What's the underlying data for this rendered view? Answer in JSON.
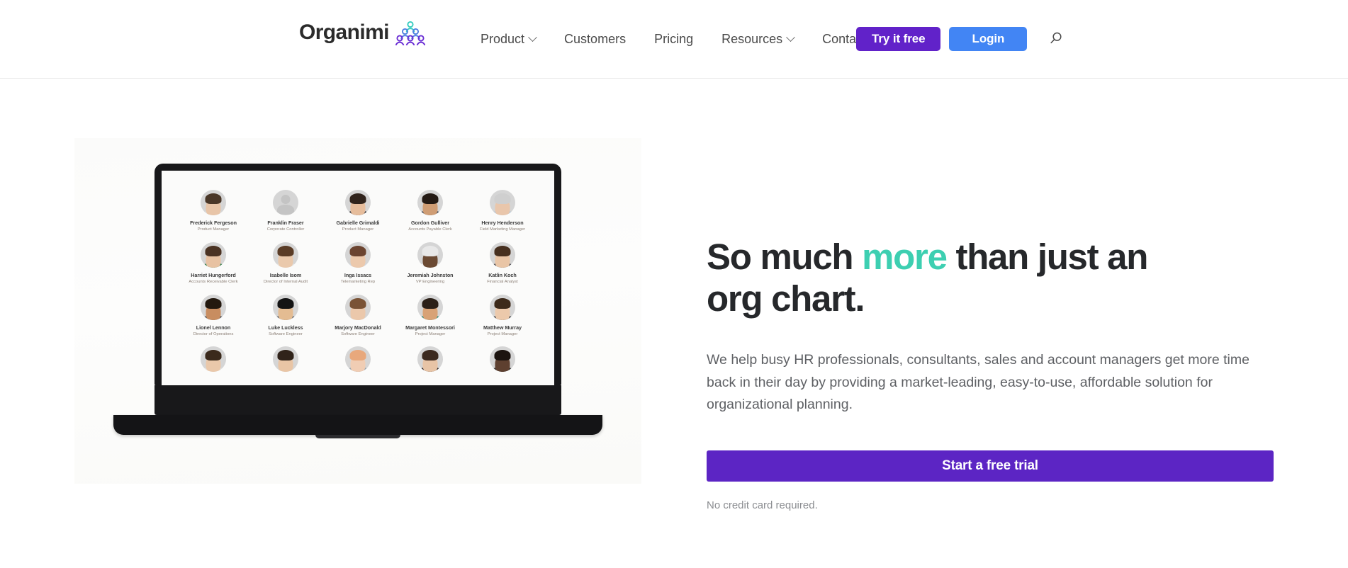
{
  "header": {
    "logo": {
      "wordmark": "Organimi",
      "icon_name": "organimi-pyramid-logo",
      "colors": {
        "top": "#35ccc0",
        "middle": "#4f7fe0",
        "bottom": "#6b2fd4"
      }
    },
    "nav": [
      {
        "label": "Product",
        "has_dropdown": true
      },
      {
        "label": "Customers",
        "has_dropdown": false
      },
      {
        "label": "Pricing",
        "has_dropdown": false
      },
      {
        "label": "Resources",
        "has_dropdown": true
      },
      {
        "label": "Contact Us",
        "has_dropdown": false
      }
    ],
    "buttons": {
      "try_free": {
        "label": "Try it free",
        "color": "#6122c9"
      },
      "login": {
        "label": "Login",
        "color": "#4285f4"
      }
    },
    "search_icon": "search-icon"
  },
  "hero": {
    "title_part1": "So much ",
    "title_accent": "more",
    "title_part2": " than just an org chart.",
    "accent_color": "#3dcfb1",
    "subtitle": "We help busy HR professionals, consultants, sales and account managers get more time back in their day by providing a market-leading, easy-to-use, affordable solution for organizational planning.",
    "cta_label": "Start a free trial",
    "cta_color": "#5c25c4",
    "cta_note": "No credit card required."
  },
  "org_chart": {
    "people": [
      {
        "name": "Frederick Fergeson",
        "title": "Product Manager",
        "avatar": "photo",
        "skin": "#e8c5a8",
        "hair": "#4a3728",
        "shirt": "#dcdcdc"
      },
      {
        "name": "Franklin Fraser",
        "title": "Corporate Controller",
        "avatar": "placeholder",
        "skin": "#c4c4c4",
        "hair": "#c4c4c4",
        "shirt": "#c4c4c4"
      },
      {
        "name": "Gabrielle Grimaldi",
        "title": "Product Manager",
        "avatar": "photo",
        "skin": "#e6bd9c",
        "hair": "#31241c",
        "shirt": "#2e2e33"
      },
      {
        "name": "Gordon Gulliver",
        "title": "Accounts Payable Clerk",
        "avatar": "photo",
        "skin": "#cf9d74",
        "hair": "#241a14",
        "shirt": "#3c4450"
      },
      {
        "name": "Henry Henderson",
        "title": "Field Marketing Manager",
        "avatar": "photo",
        "skin": "#e9c6ab",
        "hair": "#cfcfcf",
        "shirt": "#b9c7d6"
      },
      {
        "name": "Harriet Hungerford",
        "title": "Accounts Receivable Clerk",
        "avatar": "photo",
        "skin": "#e8c2a2",
        "hair": "#4b3323",
        "shirt": "#2f7d4a"
      },
      {
        "name": "Isabelle Isom",
        "title": "Director of Internal Audit",
        "avatar": "photo",
        "skin": "#eac9ac",
        "hair": "#5a3c26",
        "shirt": "#e4e4e4"
      },
      {
        "name": "Inga Issacs",
        "title": "Telemarketing Rep",
        "avatar": "photo",
        "skin": "#ecc9ac",
        "hair": "#6b4430",
        "shirt": "#cfd8e2"
      },
      {
        "name": "Jeremiah Johnston",
        "title": "VP Engineering",
        "avatar": "photo",
        "skin": "#6b4a33",
        "hair": "#e8e8e8",
        "shirt": "#f0f0f0"
      },
      {
        "name": "Katlin Koch",
        "title": "Financial Analyst",
        "avatar": "photo",
        "skin": "#e9c5a6",
        "hair": "#47301f",
        "shirt": "#3f3f45"
      },
      {
        "name": "Lionel Lennon",
        "title": "Director of Operations",
        "avatar": "photo",
        "skin": "#c88d60",
        "hair": "#23190f",
        "shirt": "#4a4f57"
      },
      {
        "name": "Luke Luckless",
        "title": "Software Engineer",
        "avatar": "photo",
        "skin": "#e4bc92",
        "hair": "#141414",
        "shirt": "#58606b"
      },
      {
        "name": "Marjory MacDonald",
        "title": "Software Engineer",
        "avatar": "photo",
        "skin": "#ebc8ab",
        "hair": "#7a5336",
        "shirt": "#d4d4d4"
      },
      {
        "name": "Margaret Montessori",
        "title": "Project Manager",
        "avatar": "photo",
        "skin": "#d8a276",
        "hair": "#2b2018",
        "shirt": "#2f8a78"
      },
      {
        "name": "Matthew Murray",
        "title": "Project Manager",
        "avatar": "photo",
        "skin": "#ecc9ab",
        "hair": "#3d2a1a",
        "shirt": "#2f3338"
      },
      {
        "name": "",
        "title": "",
        "avatar": "photo",
        "skin": "#eac8aa",
        "hair": "#3b2a1c",
        "shirt": "#e0e0e0"
      },
      {
        "name": "",
        "title": "",
        "avatar": "photo",
        "skin": "#e9c5a5",
        "hair": "#30231a",
        "shirt": "#d6d6d6"
      },
      {
        "name": "",
        "title": "",
        "avatar": "photo",
        "skin": "#f0cdb4",
        "hair": "#e8a87c",
        "shirt": "#9aa3aa"
      },
      {
        "name": "",
        "title": "",
        "avatar": "photo",
        "skin": "#e7c4a6",
        "hair": "#3c2a1f",
        "shirt": "#332b2b"
      },
      {
        "name": "",
        "title": "",
        "avatar": "photo",
        "skin": "#5e4030",
        "hair": "#1c1410",
        "shirt": "#2b2b2b"
      }
    ]
  }
}
